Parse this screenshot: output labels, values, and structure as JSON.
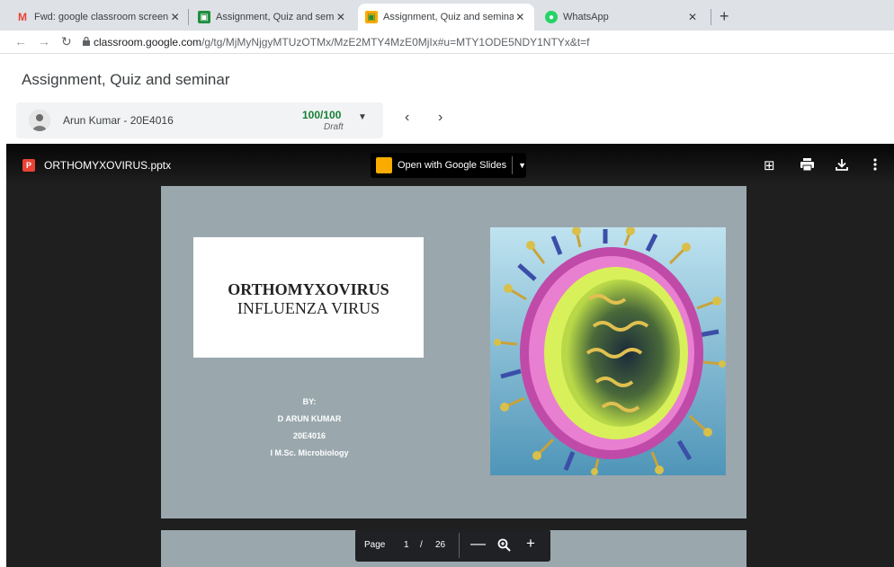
{
  "browser": {
    "tabs": [
      {
        "title": "Fwd: google classroom screen sh",
        "icon": "gmail-icon"
      },
      {
        "title": "Assignment, Quiz and seminar",
        "icon": "classroom-icon"
      },
      {
        "title": "Assignment, Quiz and seminar",
        "icon": "classroom-icon"
      },
      {
        "title": "WhatsApp",
        "icon": "whatsapp-icon"
      }
    ],
    "url_host": "classroom.google.com",
    "url_path": "/g/tg/MjMyNjgyMTUzOTMx/MzE2MTY4MzE0MjIx#u=MTY1ODE5NDY1NTYx&t=f"
  },
  "page": {
    "title": "Assignment, Quiz and seminar"
  },
  "student": {
    "name": "Arun Kumar - 20E4016",
    "grade": "100/100",
    "status": "Draft"
  },
  "viewer": {
    "file_name": "ORTHOMYXOVIRUS.pptx",
    "open_with": "Open with Google Slides",
    "page_label": "Page",
    "page_current": "1",
    "page_separator": "/",
    "page_total": "26"
  },
  "slide": {
    "title": "ORTHOMYXOVIRUS",
    "subtitle": "INFLUENZA VIRUS",
    "by_label": "BY:",
    "author": "D ARUN KUMAR",
    "roll": "20E4016",
    "course": "I M.Sc. Microbiology",
    "background": "#9aa8ae"
  }
}
